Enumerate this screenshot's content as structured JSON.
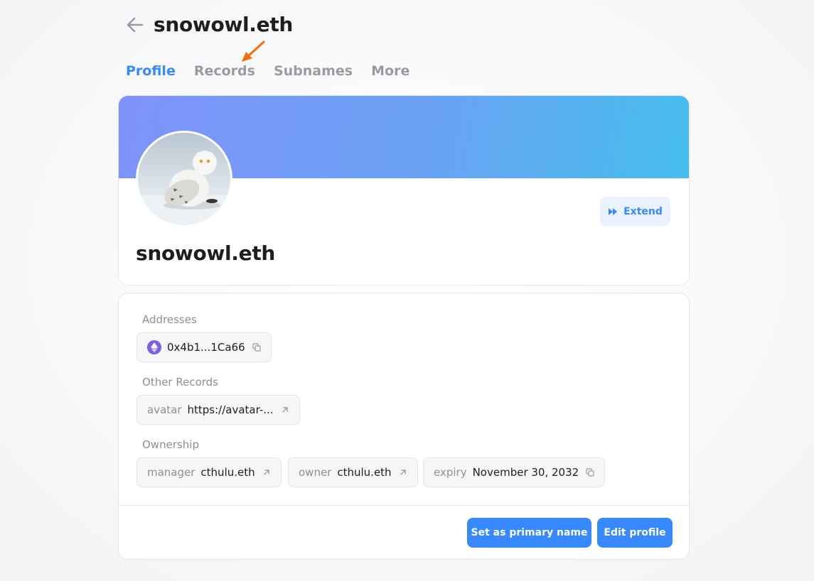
{
  "header": {
    "title": "snowowl.eth"
  },
  "tabs": [
    {
      "label": "Profile",
      "active": true
    },
    {
      "label": "Records",
      "active": false
    },
    {
      "label": "Subnames",
      "active": false
    },
    {
      "label": "More",
      "active": false
    }
  ],
  "profile": {
    "name": "snowowl.eth",
    "extend_label": "Extend",
    "banner_colors": [
      "#7f92f9",
      "#45bdec"
    ]
  },
  "addresses": {
    "label": "Addresses",
    "items": [
      {
        "icon": "ethereum-icon",
        "value": "0x4b1...1Ca66"
      }
    ]
  },
  "other_records": {
    "label": "Other Records",
    "items": [
      {
        "key": "avatar",
        "value": "https://avatar-..."
      }
    ]
  },
  "ownership": {
    "label": "Ownership",
    "items": [
      {
        "key": "manager",
        "value": "cthulu.eth"
      },
      {
        "key": "owner",
        "value": "cthulu.eth"
      },
      {
        "key": "expiry",
        "value": "November 30, 2032"
      }
    ]
  },
  "actions": {
    "set_primary_label": "Set as primary name",
    "edit_profile_label": "Edit profile"
  },
  "colors": {
    "accent": "#3889ff",
    "annotation": "#f36d12"
  }
}
